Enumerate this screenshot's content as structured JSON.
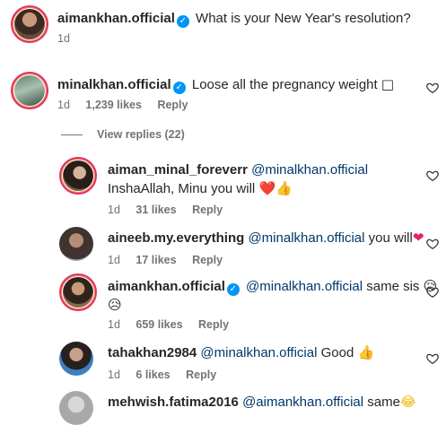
{
  "post": {
    "username": "aimankhan.official",
    "caption": "What is your New Year's resolution?",
    "time": "1d"
  },
  "comments": [
    {
      "username": "minalkhan.official",
      "verified": true,
      "text": "Loose all the pregnancy weight",
      "emoji": "□",
      "time": "1d",
      "likes": "1,239 likes",
      "reply": "Reply"
    }
  ],
  "view_replies": "View replies (22)",
  "replies": [
    {
      "username": "aiman_minal_foreverr",
      "mention": "@minalkhan.official",
      "text_line1": "InshaAllah,",
      "text_line2": "Minu you will",
      "emoji": "❤️👍",
      "time": "1d",
      "likes": "31 likes",
      "reply": "Reply"
    },
    {
      "username": "aineeb.my.everything",
      "mention": "@minalkhan.official",
      "text": "you will",
      "emoji": "❤",
      "time": "1d",
      "likes": "17 likes",
      "reply": "Reply"
    },
    {
      "username": "aimankhan.official",
      "verified": true,
      "mention": "@minalkhan.official",
      "text": "same sis",
      "emoji": "😥",
      "emoji2": "😥",
      "time": "1d",
      "likes": "659 likes",
      "reply": "Reply"
    },
    {
      "username": "tahakhan2984",
      "mention": "@minalkhan.official",
      "text": "Good",
      "emoji": "👍",
      "time": "1d",
      "likes": "6 likes",
      "reply": "Reply"
    },
    {
      "username": "mehwish.fatima2016",
      "mention": "@aimankhan.official",
      "text": "same",
      "emoji": "😂"
    }
  ],
  "icons": {
    "verified": "verified-badge-icon",
    "like": "heart-outline-icon"
  },
  "colors": {
    "mention": "#00376b",
    "meta": "#737373",
    "verified": "#0095f6",
    "story_ring": "#e1306c"
  }
}
